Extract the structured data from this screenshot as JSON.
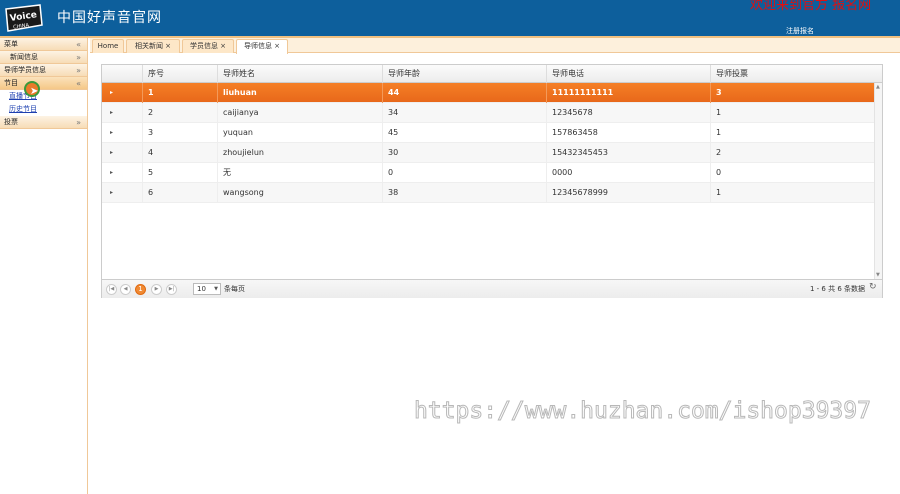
{
  "header": {
    "title": "中国好声音官网",
    "promo_text": "欢迎来到官方 报名网",
    "register_link": "注册报名"
  },
  "sidebar": {
    "root_label": "菜单",
    "items": [
      {
        "label": "新闻信息"
      },
      {
        "label": "导师学员信息"
      },
      {
        "label": "节目"
      },
      {
        "label": "投票"
      }
    ],
    "sub_items": [
      {
        "label": "直播节目"
      },
      {
        "label": "历史节目"
      }
    ]
  },
  "tabs": [
    {
      "label": "Home"
    },
    {
      "label": "相关新闻 ×"
    },
    {
      "label": "学员信息 ×"
    },
    {
      "label": "导师信息 ×"
    }
  ],
  "grid": {
    "columns": [
      "序号",
      "导师姓名",
      "导师年龄",
      "导师电话",
      "导师投票"
    ],
    "rows": [
      {
        "id": "1",
        "name": "liuhuan",
        "age": "44",
        "phone": "11111111111",
        "votes": "3"
      },
      {
        "id": "2",
        "name": "caijianya",
        "age": "34",
        "phone": "12345678",
        "votes": "1"
      },
      {
        "id": "3",
        "name": "yuquan",
        "age": "45",
        "phone": "157863458",
        "votes": "1"
      },
      {
        "id": "4",
        "name": "zhoujielun",
        "age": "30",
        "phone": "15432345453",
        "votes": "2"
      },
      {
        "id": "5",
        "name": "无",
        "age": "0",
        "phone": "0000",
        "votes": "0"
      },
      {
        "id": "6",
        "name": "wangsong",
        "age": "38",
        "phone": "12345678999",
        "votes": "1"
      }
    ],
    "selected_row": 0
  },
  "pager": {
    "current_page": "1",
    "page_size": "10",
    "page_size_label": "条每页",
    "info": "1 - 6 共 6 条数据"
  },
  "watermark": "https://www.huzhan.com/ishop39397",
  "colors": {
    "header_bg": "#0d5f9c",
    "accent": "#f07a26",
    "promo_red": "#e01010"
  }
}
